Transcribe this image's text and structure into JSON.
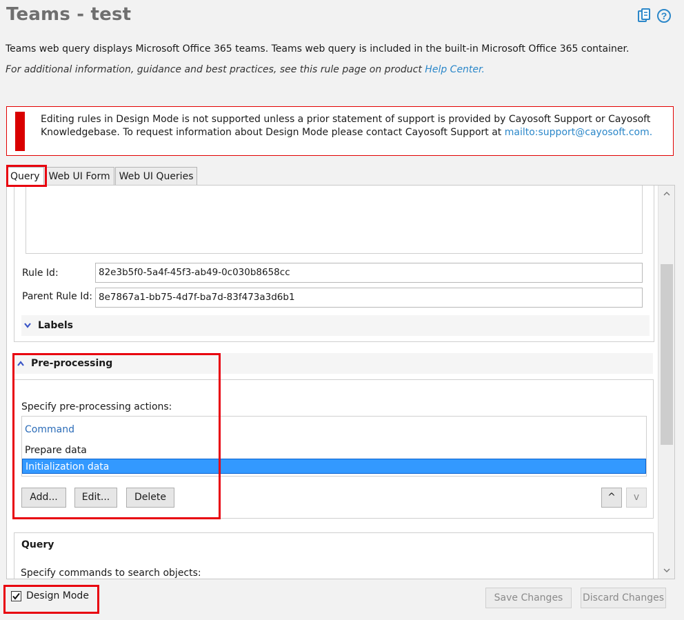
{
  "header": {
    "title": "Teams - test",
    "description": "Teams web query displays Microsoft Office 365 teams. Teams web query is included in the built-in Microsoft Office 365 container.",
    "info_prefix": "For additional information, guidance and best practices, see this rule page on product ",
    "info_link": "Help Center.",
    "icons": [
      "clipboard-icon",
      "help-icon"
    ]
  },
  "warning": {
    "text": "Editing rules in Design Mode is not supported unless a prior statement of support is provided by Cayosoft Support or Cayosoft Knowledgebase. To request information about Design Mode please contact Cayosoft Support at ",
    "link": "mailto:support@cayosoft.com."
  },
  "tabs": [
    {
      "label": "Query",
      "active": true
    },
    {
      "label": "Web UI Form",
      "active": false
    },
    {
      "label": "Web UI Queries",
      "active": false
    }
  ],
  "fields": {
    "rule_id_label": "Rule Id:",
    "rule_id_value": "82e3b5f0-5a4f-45f3-ab49-0c030b8658cc",
    "parent_rule_id_label": "Parent Rule Id:",
    "parent_rule_id_value": "8e7867a1-bb75-4d7f-ba7d-83f473a3d6b1"
  },
  "labels_section": {
    "title": "Labels"
  },
  "preprocessing": {
    "title": "Pre-processing",
    "instruction": "Specify pre-processing actions:",
    "column_header": "Command",
    "rows": [
      "Prepare data",
      "Initialization data"
    ],
    "selected_index": 1,
    "buttons": {
      "add": "Add...",
      "edit": "Edit...",
      "delete": "Delete",
      "up": "^",
      "down": "v"
    }
  },
  "query_section": {
    "title": "Query",
    "instruction": "Specify commands to search objects:"
  },
  "footer": {
    "design_mode_label": "Design Mode",
    "design_mode_checked": true,
    "save_label": "Save Changes",
    "discard_label": "Discard Changes"
  },
  "colors": {
    "accent": "#2b87c9",
    "warning": "#d90000",
    "highlight": "#e8000e",
    "selection": "#3399ff"
  }
}
